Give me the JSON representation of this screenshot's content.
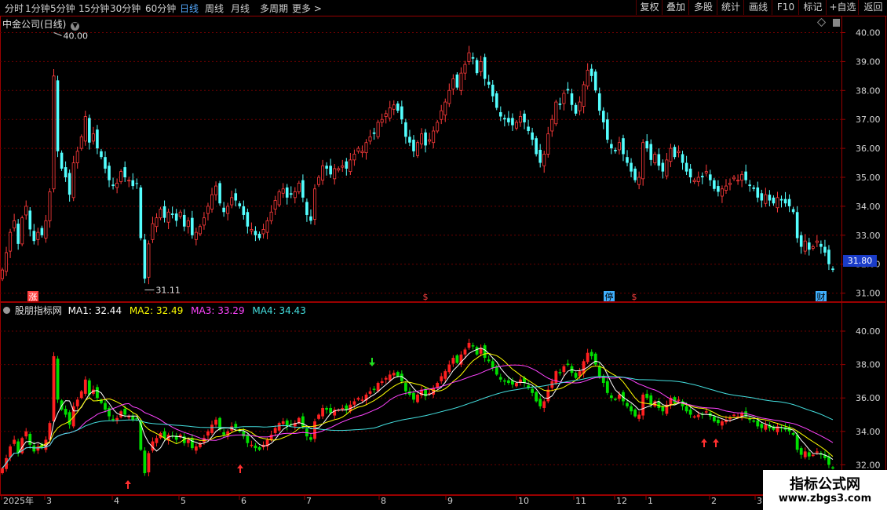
{
  "toolbar": {
    "periods": [
      "分时",
      "1分钟",
      "5分钟",
      "15分钟",
      "30分钟",
      "60分钟",
      "日线",
      "周线",
      "月线",
      "多周期",
      "更多 >"
    ],
    "active_period": "日线",
    "right_buttons": [
      "复权",
      "叠加",
      "多股",
      "统计",
      "画线",
      "F10",
      "标记",
      "+自选",
      "返回"
    ]
  },
  "stock": {
    "name": "中金公司(日线)"
  },
  "price_axis": {
    "ticks": [
      "40.00",
      "39.00",
      "38.00",
      "37.00",
      "36.00",
      "35.00",
      "34.00",
      "33.00",
      "32.00",
      "31.00"
    ],
    "current": "31.80"
  },
  "annotations": {
    "high": "40.00",
    "low": "31.11"
  },
  "event_markers": [
    "涨",
    "$",
    "停",
    "$",
    "财"
  ],
  "indicator": {
    "name": "股朋指标网",
    "ma1": "MA1: 32.44",
    "ma2": "MA2: 32.49",
    "ma3": "MA3: 33.29",
    "ma4": "MA4: 34.43",
    "axis_ticks": [
      "40.00",
      "38.00",
      "36.00",
      "34.00",
      "32.00"
    ]
  },
  "date_axis": [
    "2025年",
    "3",
    "4",
    "5",
    "6",
    "7",
    "8",
    "9",
    "10",
    "11",
    "12",
    "1",
    "2",
    "3"
  ],
  "watermark": {
    "title": "指标公式网",
    "url": "www.zbgs3.com"
  },
  "colors": {
    "up": "#ff3b3b",
    "down": "#54ffff",
    "ind_up": "#ff2020",
    "ind_down": "#00e000",
    "ma1": "#ffffff",
    "ma2": "#ffff00",
    "ma3": "#ff44ff",
    "ma4": "#44e0e0",
    "grid": "#6a0000",
    "frame": "#9a0000"
  },
  "chart_data": {
    "type": "candlestick",
    "title": "中金公司(日线)",
    "ylim": [
      30.8,
      40.3
    ],
    "closes": [
      31.8,
      32.4,
      33.1,
      33.5,
      32.7,
      33.6,
      34.0,
      33.2,
      32.8,
      33.1,
      33.0,
      33.5,
      34.5,
      38.5,
      35.9,
      35.3,
      35.0,
      34.4,
      35.5,
      35.9,
      36.4,
      37.1,
      36.2,
      36.5,
      36.0,
      35.7,
      35.3,
      34.9,
      34.7,
      34.8,
      35.2,
      35.0,
      34.9,
      34.7,
      34.8,
      32.9,
      31.5,
      32.7,
      33.4,
      33.6,
      33.9,
      33.6,
      33.8,
      33.7,
      33.5,
      33.8,
      33.3,
      33.5,
      33.0,
      33.1,
      33.3,
      33.6,
      34.0,
      34.4,
      34.7,
      34.1,
      33.8,
      34.0,
      34.3,
      34.2,
      34.0,
      33.7,
      33.3,
      33.2,
      33.0,
      32.9,
      33.2,
      33.5,
      33.8,
      34.2,
      34.5,
      34.6,
      34.3,
      34.4,
      34.5,
      34.8,
      34.3,
      33.7,
      33.5,
      34.6,
      35.0,
      35.4,
      35.3,
      35.1,
      35.3,
      35.3,
      35.4,
      35.3,
      35.6,
      35.8,
      36.0,
      35.9,
      36.2,
      36.4,
      36.5,
      36.9,
      37.0,
      37.2,
      37.4,
      37.5,
      37.3,
      37.0,
      36.4,
      36.2,
      35.9,
      36.2,
      36.5,
      36.1,
      36.3,
      36.6,
      36.9,
      37.3,
      37.6,
      38.0,
      38.4,
      38.1,
      38.6,
      38.9,
      39.3,
      39.1,
      38.6,
      39.0,
      38.4,
      38.2,
      37.8,
      37.4,
      37.1,
      37.0,
      36.9,
      36.8,
      36.9,
      37.1,
      36.9,
      36.6,
      36.3,
      35.8,
      35.5,
      35.8,
      36.5,
      37.0,
      37.6,
      37.5,
      37.9,
      38.0,
      37.5,
      37.2,
      37.6,
      38.2,
      38.7,
      38.5,
      38.0,
      37.3,
      36.9,
      36.3,
      36.0,
      35.9,
      36.2,
      35.8,
      35.5,
      35.2,
      34.9,
      35.0,
      36.2,
      36.0,
      35.6,
      35.8,
      35.4,
      35.2,
      35.6,
      36.0,
      35.7,
      35.9,
      35.5,
      35.2,
      35.0,
      34.9,
      35.0,
      35.0,
      35.2,
      34.9,
      34.6,
      34.5,
      34.6,
      34.7,
      34.8,
      35.0,
      34.9,
      35.1,
      34.9,
      34.7,
      34.6,
      34.3,
      34.2,
      34.4,
      34.2,
      34.1,
      34.3,
      34.2,
      34.1,
      34.0,
      33.8,
      32.9,
      32.6,
      32.8,
      32.5,
      32.6,
      32.8,
      32.6,
      32.4,
      32.0,
      31.8
    ]
  }
}
